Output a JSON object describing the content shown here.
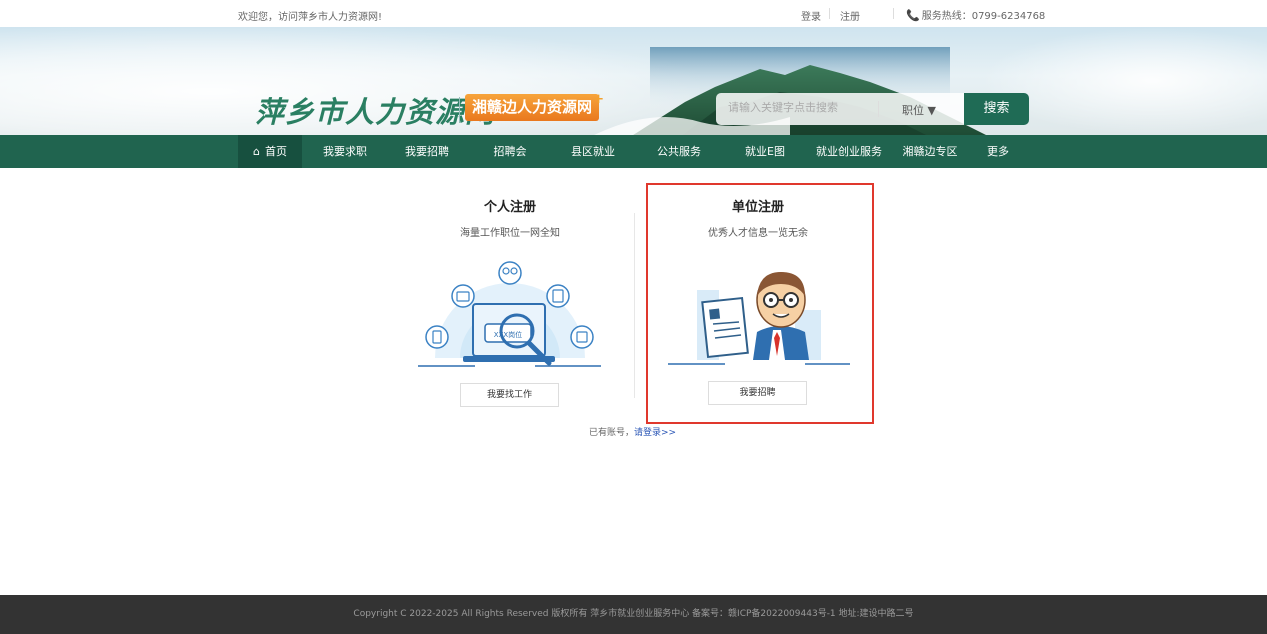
{
  "topbar": {
    "welcome": "欢迎您，访问萍乡市人力资源网!",
    "login": "登录",
    "register": "注册",
    "hotline": "服务热线：0799-6234768"
  },
  "header": {
    "logo_text": "萍乡市人力资源网",
    "logo_tag": "湘赣边人力资源网",
    "search_placeholder": "请输入关键字点击搜索",
    "search_type": "职位 ▼",
    "search_button": "搜索"
  },
  "nav": {
    "items": [
      "首页",
      "我要求职",
      "我要招聘",
      "招聘会",
      "县区就业",
      "公共服务",
      "就业E图",
      "就业创业服务",
      "湘赣边专区",
      "更多"
    ]
  },
  "personal": {
    "title": "个人注册",
    "subtitle": "海量工作职位一网全知",
    "illustration_label": "XXX岗位",
    "button": "我要找工作"
  },
  "company": {
    "title": "单位注册",
    "subtitle": "优秀人才信息一览无余",
    "button": "我要招聘"
  },
  "login_hint": {
    "text": "已有账号，",
    "link": "请登录>>"
  },
  "footer": {
    "text": "Copyright C 2022-2025 All Rights Reserved 版权所有 萍乡市就业创业服务中心 备案号：赣ICP备2022009443号-1 地址:建设中路二号"
  },
  "colors": {
    "nav_bg": "#20644f",
    "accent_green": "#1f6b55",
    "logo_orange": "#e9781e",
    "highlight_red": "#e0382d",
    "footer_bg": "#333333"
  }
}
